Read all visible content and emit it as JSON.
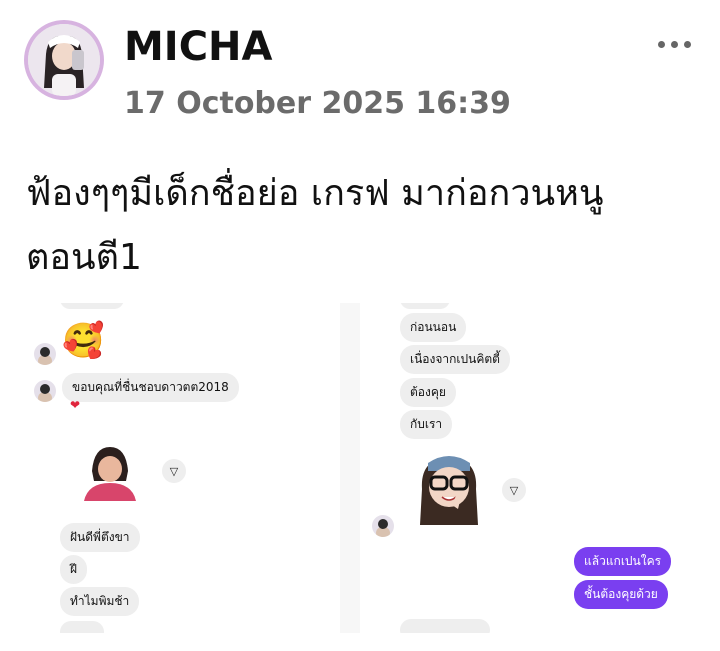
{
  "post": {
    "author": "MICHA",
    "timestamp": "17 October 2025 16:39",
    "caption_line1": "ฟ้องๆๆมีเด็กชื่อย่อ เกรฟ มาก่อกวนหนู",
    "caption_line2": "ตอนตี1"
  },
  "screenshot_left": {
    "emoji": "🥰",
    "messages": [
      "ขอบคุณที่ชื่นชอบดาวตต2018",
      "ฝันดีพี่ตึงขา",
      "ฝี",
      "ทำไมพิมช้า"
    ],
    "reaction": "❤"
  },
  "screenshot_right": {
    "messages": [
      "ก่อนนอน",
      "เนื่องจากเปนคิตตี้",
      "ต้องคุย",
      "กับเรา"
    ],
    "my_messages": [
      "แล้วแกเปนใคร",
      "ชั้นต้องคุยด้วย"
    ]
  },
  "icons": {
    "more": "more-dots-icon",
    "share": "send-triangle-icon"
  },
  "colors": {
    "my_bubble": "#7a3ff0",
    "their_bubble": "#eeeeee",
    "timestamp": "#6b6b6b"
  }
}
